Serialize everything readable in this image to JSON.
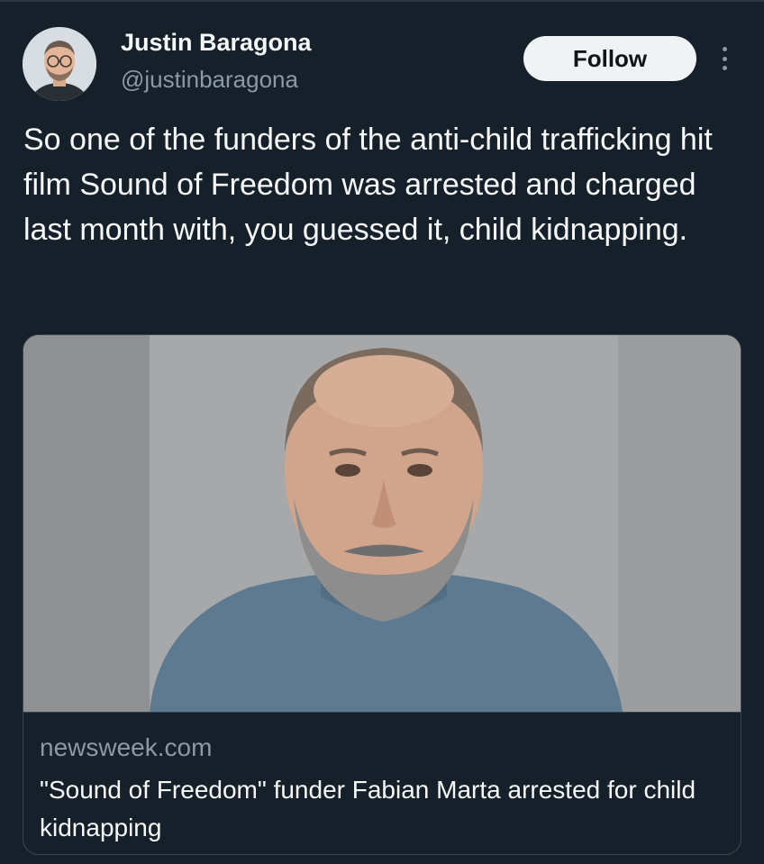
{
  "author": {
    "name": "Justin Baragona",
    "handle": "@justinbaragona"
  },
  "follow_label": "Follow",
  "tweet": {
    "text": "So one of the funders of the anti-child trafficking hit film Sound of Freedom was arrested and charged last month with, you guessed it, child kidnapping."
  },
  "link_card": {
    "domain": "newsweek.com",
    "title": "\"Sound of Freedom\" funder Fabian Marta arrested for child kidnapping"
  },
  "icons": {
    "more": "more-options-icon"
  },
  "colors": {
    "background": "#15202b",
    "text_primary": "#f7f9f9",
    "text_secondary": "#8b98a5",
    "follow_bg": "#eff3f4",
    "border": "#38444d"
  }
}
